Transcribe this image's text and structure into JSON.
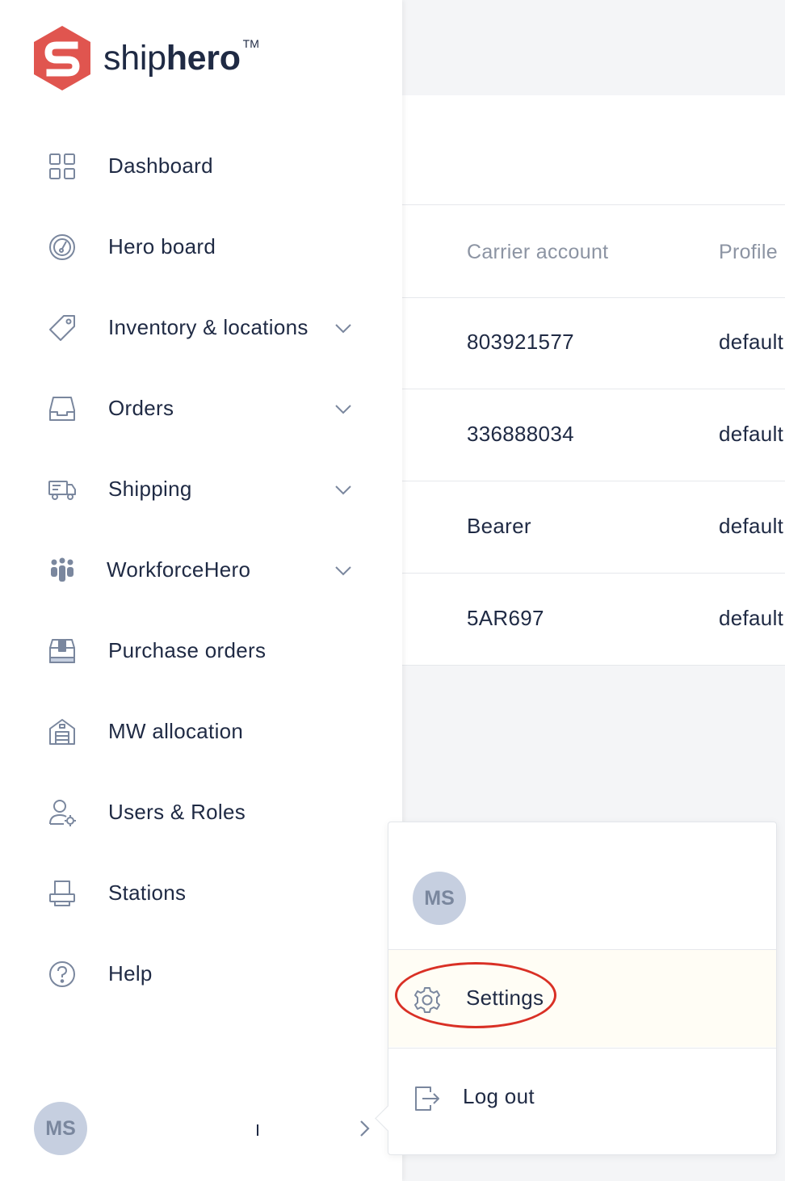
{
  "brand": {
    "name_light": "ship",
    "name_bold": "hero",
    "trademark": "TM",
    "logo_color": "#e0554f"
  },
  "nav": {
    "items": [
      {
        "label": "Dashboard",
        "icon": "grid-icon",
        "has_submenu": false
      },
      {
        "label": "Hero board",
        "icon": "speedometer-icon",
        "has_submenu": false
      },
      {
        "label": "Inventory & locations",
        "icon": "tag-icon",
        "has_submenu": true
      },
      {
        "label": "Orders",
        "icon": "inbox-tray-icon",
        "has_submenu": true
      },
      {
        "label": "Shipping",
        "icon": "truck-icon",
        "has_submenu": true
      },
      {
        "label": "WorkforceHero",
        "icon": "team-icon",
        "has_submenu": true
      },
      {
        "label": "Purchase orders",
        "icon": "package-icon",
        "has_submenu": false
      },
      {
        "label": "MW allocation",
        "icon": "warehouse-icon",
        "has_submenu": false
      },
      {
        "label": "Users & Roles",
        "icon": "user-gear-icon",
        "has_submenu": false
      },
      {
        "label": "Stations",
        "icon": "printer-icon",
        "has_submenu": false
      },
      {
        "label": "Help",
        "icon": "help-circle-icon",
        "has_submenu": false
      }
    ]
  },
  "user": {
    "initials": "MS"
  },
  "table": {
    "columns": [
      "Carrier account",
      "Profile"
    ],
    "rows": [
      [
        "803921577",
        "default"
      ],
      [
        "336888034",
        "default"
      ],
      [
        "Bearer",
        "default"
      ],
      [
        "5AR697",
        "default"
      ]
    ]
  },
  "user_menu": {
    "initials": "MS",
    "settings_label": "Settings",
    "logout_label": "Log out",
    "highlight_color": "#d93025"
  }
}
